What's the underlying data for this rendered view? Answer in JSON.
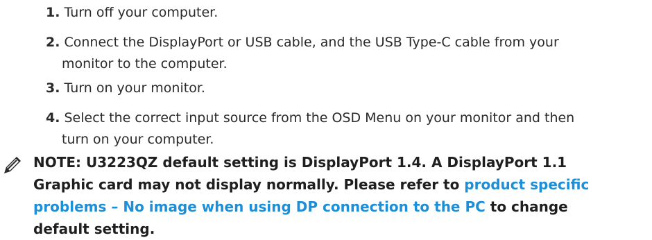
{
  "steps": [
    {
      "num": "1.",
      "text": "Turn off your computer."
    },
    {
      "num": "2.",
      "line1": "Connect the DisplayPort or USB cable, and the USB Type-C cable from your",
      "line2": "monitor to the computer."
    },
    {
      "num": "3.",
      "text": "Turn on your monitor."
    },
    {
      "num": "4.",
      "line1": "Select the correct input source from the OSD Menu on your monitor and then",
      "line2": "turn on your computer."
    }
  ],
  "note": {
    "icon": "pencil-note-icon",
    "line1": "NOTE: U3223QZ default setting is DisplayPort 1.4. A DisplayPort 1.1",
    "line2_prefix": "Graphic card  may not display normally. Please refer to ",
    "link_part1": "product specific",
    "link_part2": "problems – No image when using DP connection to the PC",
    "line3_suffix": " to change",
    "line4": "default setting.",
    "link_color": "#1e8fd6"
  }
}
